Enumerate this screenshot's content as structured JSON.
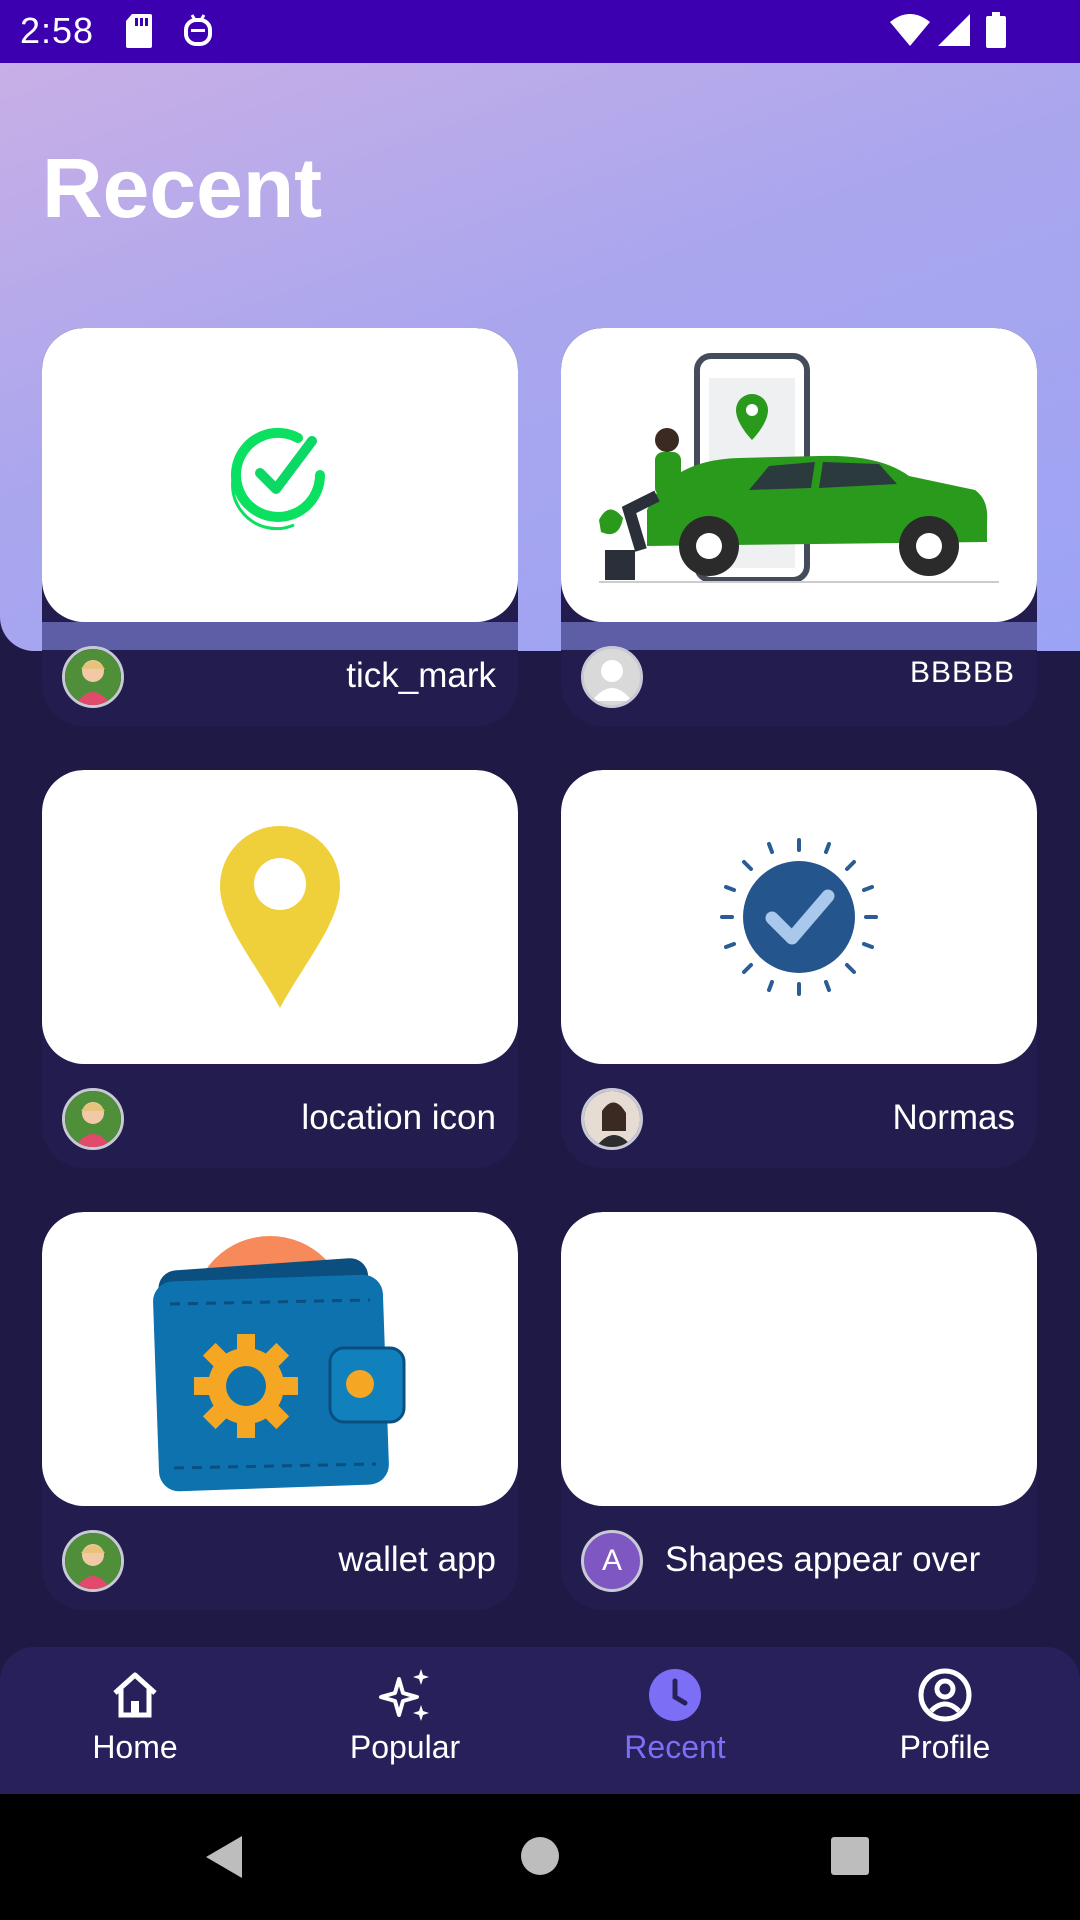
{
  "status_bar": {
    "time": "2:58",
    "icons": [
      "sd-card-icon",
      "notification-robot-icon",
      "wifi-icon",
      "cell-signal-icon",
      "battery-icon"
    ]
  },
  "page": {
    "title": "Recent"
  },
  "cards": [
    {
      "title": "tick_mark",
      "image": "tick-mark-icon",
      "avatar": "child-photo"
    },
    {
      "title": "BBBBB",
      "image": "car-location-illustration",
      "avatar": "default-person-avatar"
    },
    {
      "title": "location icon",
      "image": "location-pin-icon",
      "avatar": "child-photo"
    },
    {
      "title": "Normas",
      "image": "check-badge-icon",
      "avatar": "woman-photo"
    },
    {
      "title": "wallet app",
      "image": "wallet-gear-icon",
      "avatar": "child-photo"
    },
    {
      "title": "Shapes appear over",
      "image": "blank",
      "avatar_letter": "A"
    }
  ],
  "bottom_nav": {
    "items": [
      {
        "label": "Home",
        "icon": "home-icon"
      },
      {
        "label": "Popular",
        "icon": "sparkles-icon"
      },
      {
        "label": "Recent",
        "icon": "clock-icon",
        "active": true
      },
      {
        "label": "Profile",
        "icon": "profile-icon"
      }
    ]
  },
  "colors": {
    "status_bar": "#3d00b0",
    "background": "#1f1a45",
    "card_footer": "#221d4e",
    "nav_active": "#7c6ff5",
    "header_gradient_start": "#c8afe6",
    "header_gradient_end": "#9ca3f5"
  }
}
